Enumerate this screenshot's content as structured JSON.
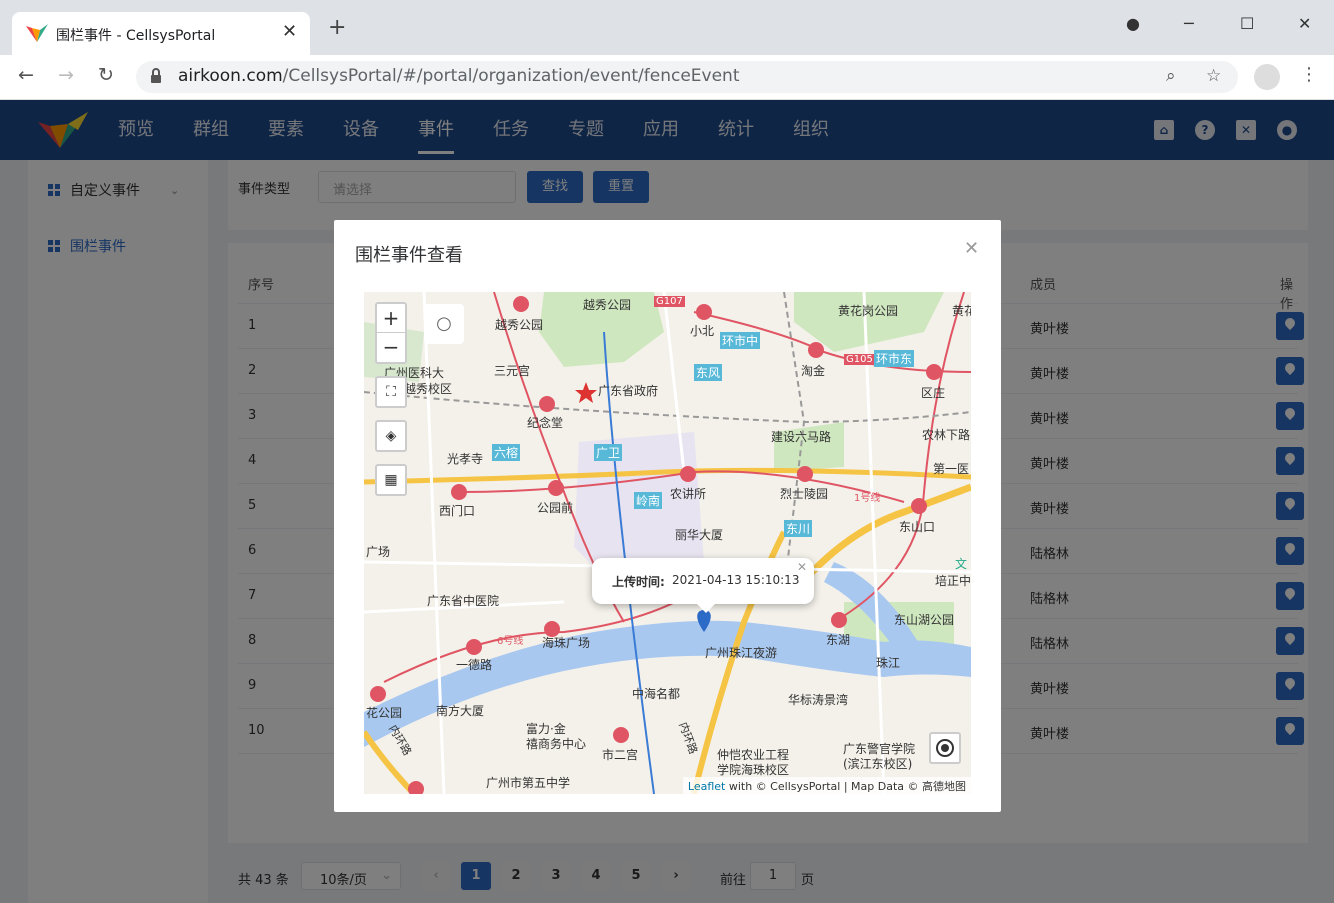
{
  "browser": {
    "tab_title": "围栏事件 - CellsysPortal",
    "url_host": "airkoon.com",
    "url_path": "/CellsysPortal/#/portal/organization/event/fenceEvent"
  },
  "nav": {
    "items": [
      "预览",
      "群组",
      "要素",
      "设备",
      "事件",
      "任务",
      "专题",
      "应用",
      "统计",
      "组织"
    ],
    "active_index": 4
  },
  "sidebar": {
    "items": [
      "自定义事件",
      "围栏事件"
    ]
  },
  "filter": {
    "label": "事件类型",
    "placeholder": "请选择",
    "search": "查找",
    "reset": "重置"
  },
  "table": {
    "headers": {
      "index": "序号",
      "member": "成员",
      "action": "操作"
    },
    "rows": [
      {
        "index": "1",
        "member": "黄叶楼"
      },
      {
        "index": "2",
        "member": "黄叶楼"
      },
      {
        "index": "3",
        "member": "黄叶楼"
      },
      {
        "index": "4",
        "member": "黄叶楼"
      },
      {
        "index": "5",
        "member": "黄叶楼"
      },
      {
        "index": "6",
        "member": "陆格林"
      },
      {
        "index": "7",
        "member": "陆格林"
      },
      {
        "index": "8",
        "member": "陆格林"
      },
      {
        "index": "9",
        "member": "黄叶楼"
      },
      {
        "index": "10",
        "member": "黄叶楼"
      }
    ]
  },
  "pagination": {
    "total": "共 43 条",
    "page_size": "10条/页",
    "pages": [
      "1",
      "2",
      "3",
      "4",
      "5"
    ],
    "current": "1",
    "goto_label": "前往",
    "goto_value": "1",
    "page_suffix": "页"
  },
  "dialog": {
    "title": "围栏事件查看",
    "popup_label": "上传时间:",
    "popup_time": "2021-04-13 15:10:13",
    "attribution_link": "Leaflet",
    "attribution_text": " with © CellsysPortal | Map Data © 高德地图",
    "map_labels": [
      "越秀公园",
      "越秀公园",
      "小北",
      "环市中",
      "黄花岗公园",
      "黄花",
      "三元宫",
      "广东省政府",
      "淘金",
      "区庄",
      "广州医科大",
      "越秀校区",
      "东风",
      "纪念堂",
      "建设六马路",
      "农林下路",
      "光孝寺",
      "六榕",
      "广卫",
      "第一医",
      "西门口",
      "公园前",
      "农讲所",
      "烈士陵园",
      "东山口",
      "岭南",
      "丽华大厦",
      "东川",
      "广场",
      "文",
      "培正中",
      "广东省中医院",
      "东山湖公园",
      "东湖",
      "海珠广场",
      "一德路",
      "广州珠江夜游",
      "珠江",
      "中海名都",
      "华标涛景湾",
      "花公园",
      "南方大厦",
      "富力·金",
      "禧商务中心",
      "市二宫",
      "仲恺农业工程",
      "学院海珠校区",
      "广东警官学院",
      "(滨江东校区)",
      "广州市第五中学",
      "G107",
      "G105",
      "环市东",
      "6号线",
      "1号线",
      "内环路",
      "内环路"
    ]
  },
  "colors": {
    "header_bg": "#1e4a8c",
    "primary": "#2c6ac7",
    "river": "#a9c8ef",
    "road_yellow": "#f6c445",
    "metro_red": "#e05563"
  }
}
